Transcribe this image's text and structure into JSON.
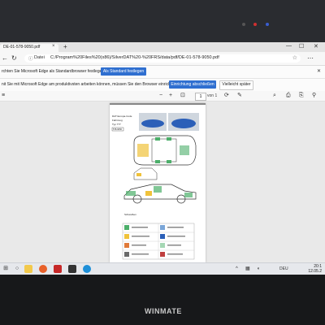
{
  "browser": {
    "tab_title": "DE-01-578-9050.pdf",
    "tab_close": "×",
    "new_tab": "+",
    "window_controls": [
      "—",
      "☐",
      "✕"
    ],
    "nav": {
      "back": "←",
      "refresh": "↻",
      "home": "⌂"
    },
    "address": {
      "info_icon": "ⓘ",
      "label": "Datei",
      "url": "C:/Program%20Files%20(x86)/SilverDAT%20-%20FRS/data/pdf/DE-01-578-9050.pdf",
      "star": "☆"
    }
  },
  "infobar_default": {
    "text": "rchten Sie Microsoft Edge als Standardbrowser festlegen?",
    "button": "Als Standard festlegen",
    "close": "✕"
  },
  "infobar_setup": {
    "text": "nit Sie mit Microsoft Edge am produktivsten arbeiten können, müssen Sie den Browser einrichten.",
    "primary_button": "Einrichtung abschließen",
    "secondary_button": "Vielleicht später"
  },
  "pdf_toolbar": {
    "left_icon": "≡",
    "zoom_minus": "−",
    "zoom_plus": "+",
    "fit_icon": "⊡",
    "page_current": "1",
    "page_total": "von 1",
    "rotate_icon": "⟳",
    "draw_icon": "✎",
    "search_icon": "⌕",
    "print_icon": "⎙",
    "save_icon": "⎘",
    "pin_icon": "⚲"
  },
  "document": {
    "brand_lines": [
      "DAT Europa-Code",
      "Fahrzeug",
      "Typ 7??"
    ],
    "code": "578-9050",
    "footnote": "Schweißen"
  },
  "taskbar": {
    "items": [
      "start-icon",
      "search-icon",
      "task-view-icon",
      "explorer-icon",
      "firefox-icon",
      "pdf-reader-icon",
      "silverdat-icon",
      "edge-icon"
    ],
    "tray_expand": "^",
    "language": "DEU",
    "clock_time": "20:1",
    "clock_date": "12.05.2"
  },
  "monitor": {
    "brand": "WINMATE"
  },
  "colors": {
    "accent": "#2f6fd0",
    "taskbar": "#e6e8ec",
    "bezel": "#1b1d20",
    "car_blue": "#2b5fb8",
    "zone_green": "#4caf6a"
  }
}
